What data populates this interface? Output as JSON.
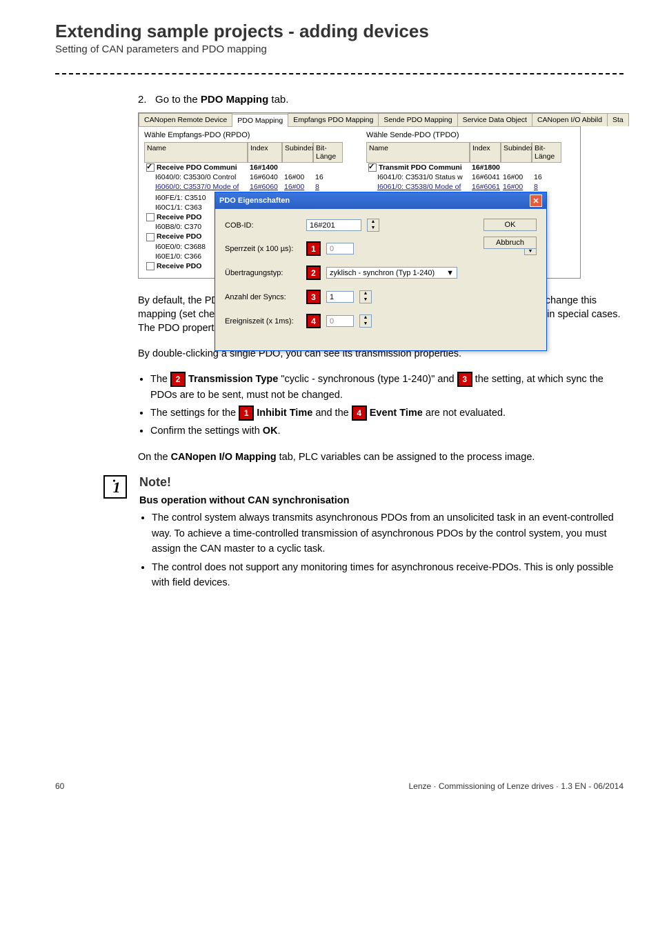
{
  "header": {
    "title": "Extending sample projects - adding devices",
    "subtitle": "Setting of CAN parameters and PDO mapping"
  },
  "step": {
    "num": "2.",
    "pre": "Go to the ",
    "bold": "PDO Mapping",
    "post": " tab."
  },
  "screenshot": {
    "tabs": {
      "t0": "CANopen Remote Device",
      "t1": "PDO Mapping",
      "t2": "Empfangs PDO Mapping",
      "t3": "Sende PDO Mapping",
      "t4": "Service Data Object",
      "t5": "CANopen I/O Abbild",
      "t6": "Sta"
    },
    "left": {
      "caption": "Wähle Empfangs-PDO (RPDO)",
      "cols": {
        "c0": "Name",
        "c1": "Index",
        "c2": "Subindex",
        "c3": "Bit-Länge"
      },
      "r0": {
        "name": "Receive PDO Communi",
        "idx": "16#1400",
        "sub": "",
        "len": ""
      },
      "r1": {
        "name": "I6040/0: C3530/0 Control",
        "idx": "16#6040",
        "sub": "16#00",
        "len": "16"
      },
      "r2": {
        "name": "I6060/0: C3537/0 Mode of",
        "idx": "16#6060",
        "sub": "16#00",
        "len": "8"
      },
      "r3": {
        "name": "I60FE/1: C3510"
      },
      "r4": {
        "name": "I60C1/1: C363"
      },
      "r5": {
        "name": "Receive PDO"
      },
      "r6": {
        "name": "I60B8/0: C370"
      },
      "r7": {
        "name": "Receive PDO"
      },
      "r8": {
        "name": "I60E0/0: C3688"
      },
      "r9": {
        "name": "I60E1/0: C366"
      },
      "r10": {
        "name": "Receive PDO"
      }
    },
    "right": {
      "caption": "Wähle Sende-PDO (TPDO)",
      "cols": {
        "c0": "Name",
        "c1": "Index",
        "c2": "Subindex",
        "c3": "Bit-Länge"
      },
      "r0": {
        "name": "Transmit PDO Communi",
        "idx": "16#1800",
        "sub": "",
        "len": ""
      },
      "r1": {
        "name": "I6041/0: C3531/0 Status w",
        "idx": "16#6041",
        "sub": "16#00",
        "len": "16"
      },
      "r2": {
        "name": "I6061/0: C3538/0 Mode of",
        "idx": "16#6061",
        "sub": "16#00",
        "len": "8"
      }
    },
    "popup": {
      "title": "PDO Eigenschaften",
      "cob_lbl": "COB-ID:",
      "cob_val": "16#201",
      "f1_lbl": "Sperrzeit (x 100 µs):",
      "f1_val": "0",
      "f2_lbl": "Übertragungstyp:",
      "f2_val": "zyklisch - synchron (Typ 1-240)",
      "f3_lbl": "Anzahl der Syncs:",
      "f3_val": "1",
      "f4_lbl": "Ereigniszeit (x 1ms):",
      "f4_val": "0",
      "ok": "OK",
      "cancel": "Abbruch"
    }
  },
  "para1": "By default, the PDO mapping is optimised for the corresponding application. It is possible to change this mapping (set checkmark). Due to the limited bandwidth of the CAN bus, this is only sensible in special cases. The PDO properties are pre-assigned sensibly as well and should not be changed.",
  "para2": "By double-clicking a single PDO, you can see its transmission properties.",
  "bul1": {
    "a": "The ",
    "b": "Transmission Type",
    "c": " \"cyclic - synchronous (type 1-240)\" and ",
    "d": " the setting, at which sync the PDOs are to be sent, must not be changed."
  },
  "bul2": {
    "a": "The settings for the ",
    "b": "Inhibit Time",
    "c": " and the ",
    "d": "Event Time",
    "e": " are not evaluated."
  },
  "bul3": {
    "a": "Confirm the settings with ",
    "b": "OK",
    "c": "."
  },
  "para3a": "On the ",
  "para3b": "CANopen I/O Mapping",
  "para3c": " tab, PLC variables can be assigned to the process image.",
  "note": {
    "title": "Note!",
    "sub": "Bus operation without CAN synchronisation",
    "li1": "The control system always transmits asynchronous PDOs from an unsolicited task in an event-controlled way. To achieve a time-controlled transmission of asynchronous PDOs by the control system, you must assign the CAN master to a cyclic task.",
    "li2": "The control does not support any monitoring times for asynchronous receive-PDOs. This is only possible with field devices."
  },
  "footer": {
    "page": "60",
    "right": "Lenze · Commissioning of Lenze drives · 1.3 EN - 06/2014"
  },
  "badges": {
    "b1": "1",
    "b2": "2",
    "b3": "3",
    "b4": "4"
  }
}
